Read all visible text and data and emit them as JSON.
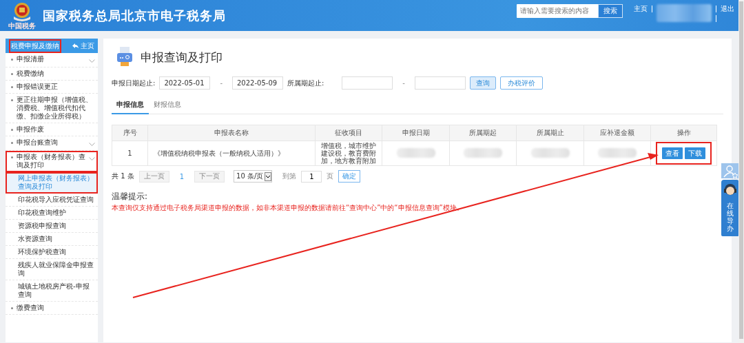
{
  "header": {
    "title": "国家税务总局北京市电子税务局",
    "logo_caption": "中国税务",
    "search": {
      "placeholder": "请输入需要搜索的内容",
      "button": "搜索"
    },
    "home_link": "主页",
    "user_redacted": true,
    "logout_link": "退出"
  },
  "sidebar": {
    "title": "税费申报及缴纳",
    "title_highlighted": true,
    "home": "主页",
    "items": [
      {
        "label": "申报清册",
        "expandable": true,
        "highlighted": false
      },
      {
        "label": "税费缴纳",
        "expandable": false,
        "highlighted": false
      },
      {
        "label": "申报错误更正",
        "expandable": false,
        "highlighted": false
      },
      {
        "label": "更正往期申报（增值税、消费税、增值税代扣代缴、扣缴企业所得税）",
        "expandable": false,
        "highlighted": false
      },
      {
        "label": "申报作废",
        "expandable": false,
        "highlighted": false
      },
      {
        "label": "申报台账查询",
        "expandable": true,
        "highlighted": false
      },
      {
        "label": "申报表（财务报表）查询及打印",
        "expandable": true,
        "highlighted": true,
        "children": [
          {
            "label": "网上申报表（财务报表）查询及打印",
            "selected": true,
            "highlighted": true
          },
          {
            "label": "印花税导入应税凭证查询",
            "selected": false,
            "highlighted": false
          },
          {
            "label": "印花税查询维护",
            "selected": false,
            "highlighted": false
          },
          {
            "label": "资源税申报查询",
            "selected": false,
            "highlighted": false
          },
          {
            "label": "水资源查询",
            "selected": false,
            "highlighted": false
          },
          {
            "label": "环境保护税查询",
            "selected": false,
            "highlighted": false
          },
          {
            "label": "残疾人就业保障金申报查询",
            "selected": false,
            "highlighted": false
          },
          {
            "label": "城镇土地税房产税-申报查询",
            "selected": false,
            "highlighted": false
          }
        ]
      },
      {
        "label": "缴费查询",
        "expandable": false,
        "highlighted": false
      }
    ]
  },
  "main": {
    "title": "申报查询及打印",
    "filters": [
      {
        "label": "申报日期起止:",
        "from": "2022-05-01",
        "separator": "-",
        "to": "2022-05-09"
      },
      {
        "label": "所属期起止:",
        "separator": "-"
      }
    ],
    "buttons": [
      {
        "label": "查询",
        "kind": "primary"
      },
      {
        "label": "办税评价",
        "kind": "outline"
      }
    ],
    "tabs": [
      {
        "label": "申报信息",
        "selected": true
      },
      {
        "label": "财报信息",
        "selected": false
      }
    ],
    "table": {
      "columns": [
        "序号",
        "申报表名称",
        "征收项目",
        "申报日期",
        "所属期起",
        "所属期止",
        "应补退金额",
        "操作"
      ],
      "rows": [
        {
          "cells": [
            {
              "kind": "text",
              "text": "1"
            },
            {
              "kind": "text",
              "text": "《增值税纳税申报表（一般纳税人适用）》"
            },
            {
              "kind": "text",
              "text": "增值税，城市维护建设税，教育费附加，地方教育附加"
            },
            {
              "kind": "redacted"
            },
            {
              "kind": "redacted"
            },
            {
              "kind": "redacted"
            },
            {
              "kind": "redacted"
            },
            {
              "kind": "actions",
              "actions": [
                "查看",
                "下载"
              ],
              "highlighted": true
            }
          ]
        }
      ]
    },
    "pagination": {
      "total": "共 1 条",
      "prev": "上一页",
      "prev_disabled": true,
      "page": "1",
      "next": "下一页",
      "next_disabled": true,
      "page_size": "10 条/页",
      "goto_label": "到第",
      "goto_value": "1",
      "page_unit": "页",
      "confirm": "确定"
    },
    "tip": {
      "title": "温馨提示:",
      "text": "本查询仅支持通过电子税务局渠道申报的数据，如非本渠道申报的数据请前往“查询中心”中的“申报信息查询”模块。"
    }
  },
  "help_widget": {
    "label": "在线导办"
  },
  "annotation": {
    "arrow": true
  }
}
